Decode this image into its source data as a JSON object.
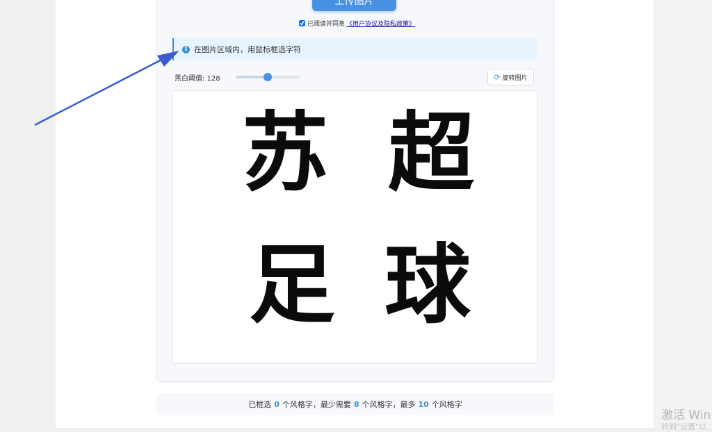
{
  "upload_button": {
    "label": "上传图片"
  },
  "agreement": {
    "checked": true,
    "prefix": "已阅读并同意",
    "link": "《用户协议及隐私政策》"
  },
  "info": {
    "text": "在图片区域内，用鼠标框选字符"
  },
  "threshold": {
    "label": "黑白阈值: 128",
    "value": 128,
    "max": 255
  },
  "rotate_button": {
    "label": "旋转图片"
  },
  "image": {
    "characters": [
      "苏",
      "超",
      "足",
      "球"
    ]
  },
  "status": {
    "part1": "已框选",
    "selected": "0",
    "part2": "个风格字，最少需要",
    "min": "8",
    "part3": "个风格字，最多",
    "max": "10",
    "part4": "个风格字"
  },
  "watermark": {
    "title": "激活 Win",
    "subtitle": "转到\"设置\"以"
  },
  "colors": {
    "accent": "#4a90e2",
    "info_bg": "#e8f4fd",
    "arrow": "#3b5bd1"
  }
}
